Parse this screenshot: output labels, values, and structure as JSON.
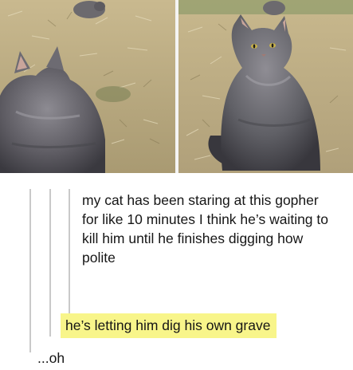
{
  "images": [
    {
      "subject": "cat-watching-gopher-back-view"
    },
    {
      "subject": "cat-looking-over-shoulder"
    }
  ],
  "posts": {
    "original": "my cat has been staring at this gopher for like 10 minutes I think he’s waiting to kill him until he finishes digging how polite",
    "reply": "he’s letting him dig his own grave",
    "reply_highlight_color": "#f8f58a",
    "final": "...oh"
  }
}
